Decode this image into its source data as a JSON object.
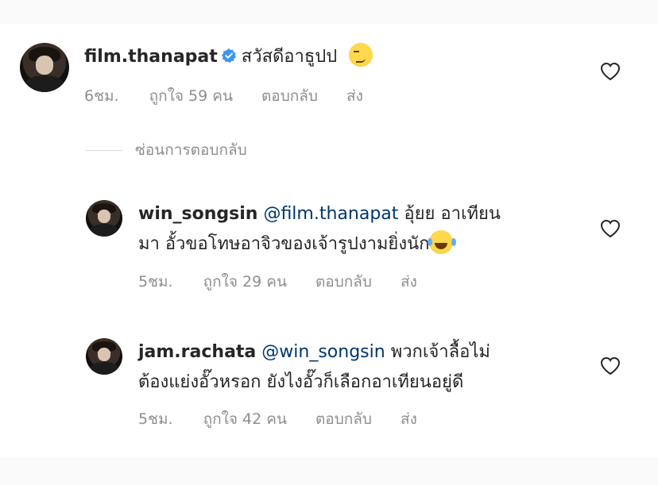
{
  "comments": [
    {
      "username": "film.thanapat",
      "verified": true,
      "text": "สวัสดีอาธูปป",
      "emoji": "smirk-emoji",
      "time": "6ชม.",
      "likes": "ถูกใจ 59 คน",
      "reply": "ตอบกลับ",
      "send": "ส่ง"
    },
    {
      "username": "win_songsin",
      "mention": "@film.thanapat",
      "text_line1": "อุ้ยย อาเทียน",
      "text_line2": "มา อั้วขอโทษอาจิวของเจ้ารูปงามยิ่งนัก",
      "emoji": "laughing-emoji",
      "time": "5ชม.",
      "likes": "ถูกใจ 29 คน",
      "reply": "ตอบกลับ",
      "send": "ส่ง"
    },
    {
      "username": "jam.rachata",
      "mention": "@win_songsin",
      "text_line1": "พวกเจ้าลื้อไม่",
      "text_line2": "ต้องแย่งอั๊วหรอก ยังไงอั๊วก็เลือกอาเทียนอยู่ดี",
      "time": "5ชม.",
      "likes": "ถูกใจ 42 คน",
      "reply": "ตอบกลับ",
      "send": "ส่ง"
    }
  ],
  "hide_replies": "ซ่อนการตอบกลับ",
  "colors": {
    "text": "#262626",
    "meta": "#8e8e8e",
    "mention": "#00376b",
    "verified": "#3897f0",
    "background": "#fafafa",
    "panel": "#ffffff"
  },
  "icons": [
    "verified-badge-icon",
    "heart-icon",
    "smirk-emoji",
    "laughing-emoji"
  ]
}
